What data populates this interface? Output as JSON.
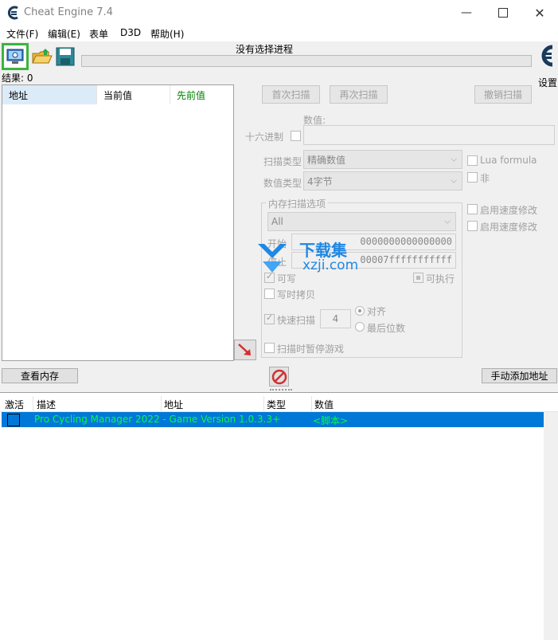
{
  "window": {
    "title": "Cheat Engine 7.4"
  },
  "menu": [
    {
      "label": "文件(F)"
    },
    {
      "label": "编辑(E)"
    },
    {
      "label": "表单"
    },
    {
      "label": "D3D"
    },
    {
      "label": "帮助(H)"
    }
  ],
  "process": {
    "label": "没有选择进程"
  },
  "settings": {
    "label": "设置"
  },
  "results": {
    "label": "结果: 0"
  },
  "result_list": {
    "headers": [
      "地址",
      "当前值",
      "先前值"
    ]
  },
  "scan": {
    "first_scan": "首次扫描",
    "next_scan": "再次扫描",
    "undo_scan": "撤销扫描",
    "value_label": "数值:",
    "hex_label": "十六进制",
    "scan_type_label": "扫描类型",
    "scan_type_value": "精确数值",
    "value_type_label": "数值类型",
    "value_type_value": "4字节",
    "lua_formula": "Lua formula",
    "not_label": "非",
    "mem_options_title": "内存扫描选项",
    "mem_region": "All",
    "start_label": "开始",
    "start_value": "0000000000000000",
    "stop_label": "停止",
    "stop_value": "00007fffffffffff",
    "writable": "可写",
    "executable": "可执行",
    "copy_on_write": "写时拷贝",
    "fast_scan": "快速扫描",
    "fast_scan_value": "4",
    "align": "对齐",
    "last_digits": "最后位数",
    "pause_game": "扫描时暂停游戏",
    "speedhack1": "启用速度修改",
    "speedhack2": "启用速度修改"
  },
  "watermark": {
    "brand": "下载集",
    "domain": "xzji.com"
  },
  "buttons": {
    "view_memory": "查看内存",
    "add_address": "手动添加地址"
  },
  "address_table": {
    "headers": [
      "激活",
      "描述",
      "地址",
      "类型",
      "数值"
    ],
    "rows": [
      {
        "active": "",
        "description": "Pro Cycling Manager 2022 - Game Version 1.0.3.3+",
        "address": "",
        "type": "",
        "value": "<脚本>"
      }
    ]
  },
  "colors": {
    "selection": "#0078d7",
    "row_text": "#00ff40",
    "toolbar_highlight": "#3cb43c",
    "prev_value": "#008000"
  }
}
